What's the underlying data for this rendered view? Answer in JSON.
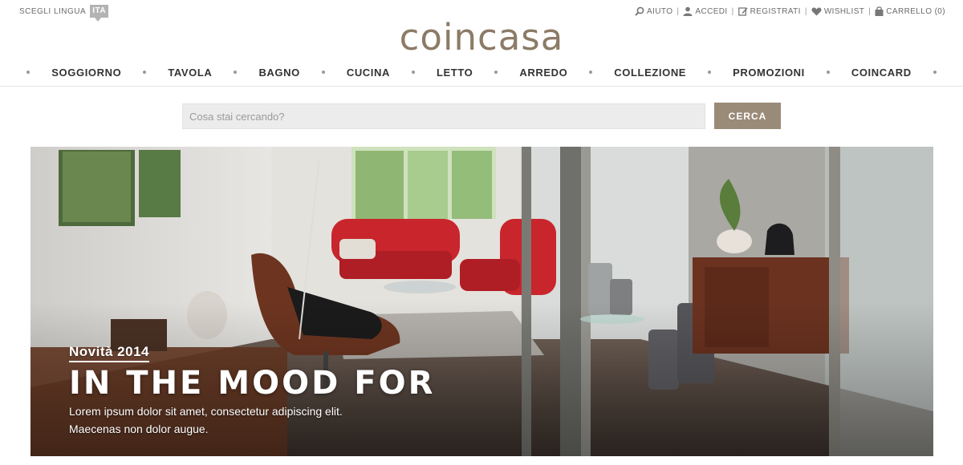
{
  "language": {
    "label": "SCEGLI LINGUA",
    "current": "ITA"
  },
  "utility_links": [
    {
      "icon": "search-icon",
      "label": "AIUTO"
    },
    {
      "icon": "user-icon",
      "label": "ACCEDI"
    },
    {
      "icon": "edit-icon",
      "label": "REGISTRATI"
    },
    {
      "icon": "heart-icon",
      "label": "WISHLIST"
    },
    {
      "icon": "bag-icon",
      "label": "CARRELLO (0)"
    }
  ],
  "logo": "coincasa",
  "nav": [
    {
      "label": "SOGGIORNO"
    },
    {
      "label": "TAVOLA"
    },
    {
      "label": "BAGNO"
    },
    {
      "label": "CUCINA"
    },
    {
      "label": "LETTO"
    },
    {
      "label": "ARREDO"
    },
    {
      "label": "COLLEZIONE"
    },
    {
      "label": "PROMOZIONI"
    },
    {
      "label": "COINCARD"
    }
  ],
  "search": {
    "placeholder": "Cosa stai cercando?",
    "button": "CERCA"
  },
  "hero": {
    "kicker": "Novità 2014",
    "title": "IN THE MOOD FOR",
    "description_line1": "Lorem ipsum dolor sit amet, consectetur adipiscing elit.",
    "description_line2": "Maecenas non dolor augue."
  },
  "colors": {
    "brand": "#8c7b66",
    "search_button": "#9a8a78",
    "search_field": "#ececec"
  }
}
